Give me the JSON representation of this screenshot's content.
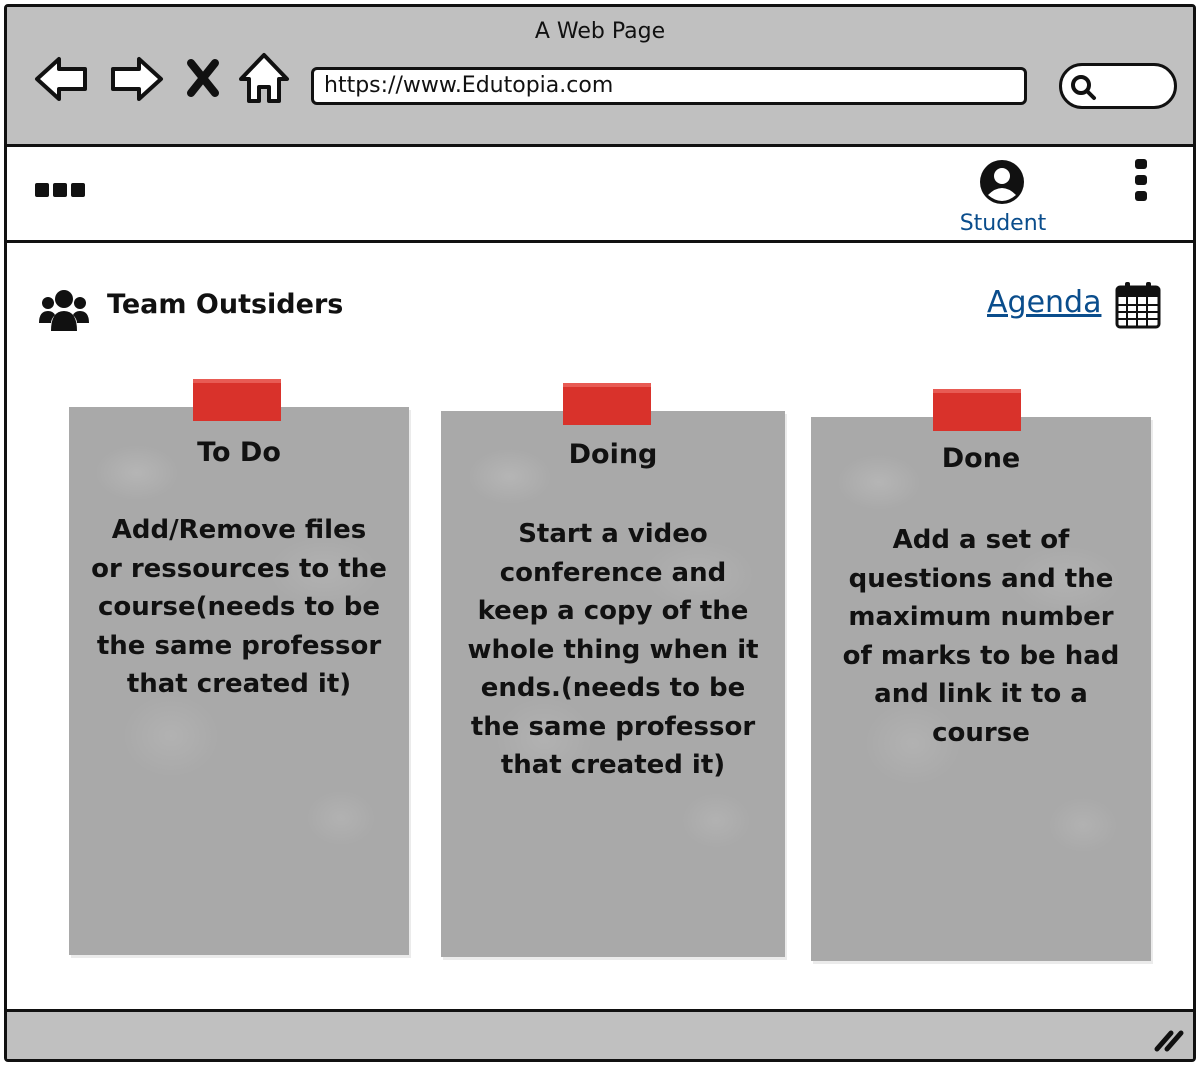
{
  "window": {
    "title": "A Web Page"
  },
  "browser": {
    "url": "https://www.Edutopia.com",
    "icons": [
      "back-arrow-icon",
      "forward-arrow-icon",
      "close-x-icon",
      "home-icon",
      "search-icon"
    ]
  },
  "appbar": {
    "menu_icon": "hamburger-dots-icon",
    "profile_label": "Student",
    "profile_icon": "user-avatar-icon",
    "more_icon": "vertical-dots-icon",
    "link_color": "#0a4d8c"
  },
  "team": {
    "icon": "users-group-icon",
    "title": "Team Outsiders",
    "agenda_label": "Agenda",
    "agenda_icon": "calendar-icon"
  },
  "board": {
    "note_color": "#a9a9a9",
    "tape_color": "#d9322b",
    "columns": [
      {
        "title": "To Do",
        "lines": [
          "Add/Remove files",
          "or ressources to the",
          "course(needs to be",
          "the same professor",
          "that created it)"
        ]
      },
      {
        "title": "Doing",
        "lines": [
          "Start a video",
          "conference and",
          "keep a copy of the",
          "whole thing when it",
          "ends.(needs to be",
          "the same professor",
          "that created it)"
        ]
      },
      {
        "title": "Done",
        "lines": [
          "Add a set of",
          "questions and the",
          "maximum number",
          "of marks to be had",
          "and link it to a",
          "course"
        ]
      }
    ]
  }
}
